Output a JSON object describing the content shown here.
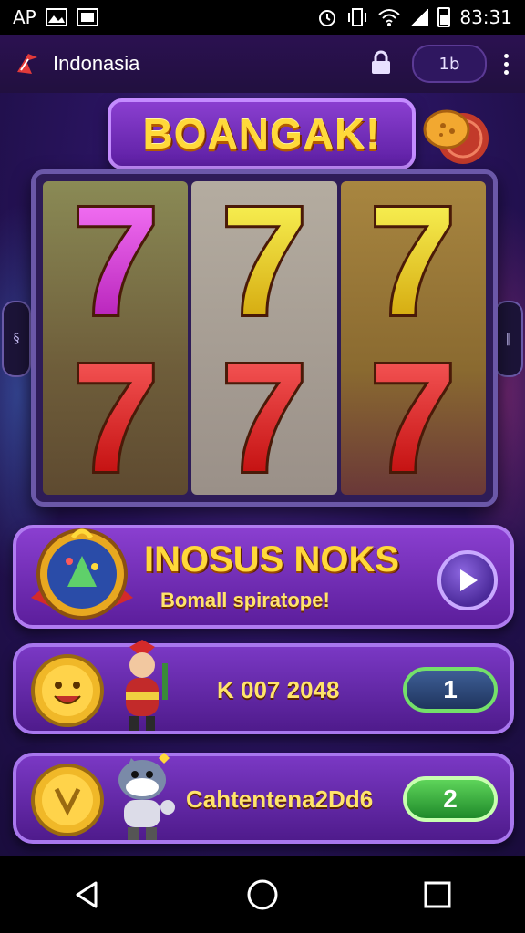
{
  "status_bar": {
    "left_text": "AP",
    "time": "83:31",
    "icons": [
      "image-icon",
      "photo-icon",
      "alarm-icon",
      "vibrate-icon",
      "wifi-icon",
      "signal-icon",
      "battery-icon"
    ]
  },
  "app_bar": {
    "title": "Indonasia",
    "counter": "1b",
    "icons": [
      "app-logo-icon",
      "lock-icon",
      "more-vert-icon"
    ]
  },
  "game": {
    "banner": "BOANGAK!",
    "reels": [
      [
        {
          "symbol": "7",
          "color": "#d23ad6"
        },
        {
          "symbol": "7",
          "color": "#e01d1d"
        }
      ],
      [
        {
          "symbol": "7",
          "color": "#f5c21a"
        },
        {
          "symbol": "7",
          "color": "#e01d1d"
        }
      ],
      [
        {
          "symbol": "7",
          "color": "#f5c21a"
        },
        {
          "symbol": "7",
          "color": "#e01d1d"
        }
      ]
    ],
    "side_left_label": "§",
    "side_right_label": "‖"
  },
  "bonus": {
    "title": "INOSUS NOKS",
    "subtitle": "Bomall spiratope!",
    "play_icon": "play-icon"
  },
  "rows": [
    {
      "text": "K 007 2048",
      "button": "1",
      "button_color": "#2b4a7e"
    },
    {
      "text": "Cahtentena2Dd6",
      "button": "2",
      "button_color": "#2aa037"
    }
  ],
  "navbar": {
    "icons": [
      "back-icon",
      "home-icon",
      "recents-icon"
    ]
  },
  "colors": {
    "accent_gold": "#ffd93a",
    "panel_purple": "#7a38c4",
    "bg_dark": "#1a0d33"
  }
}
